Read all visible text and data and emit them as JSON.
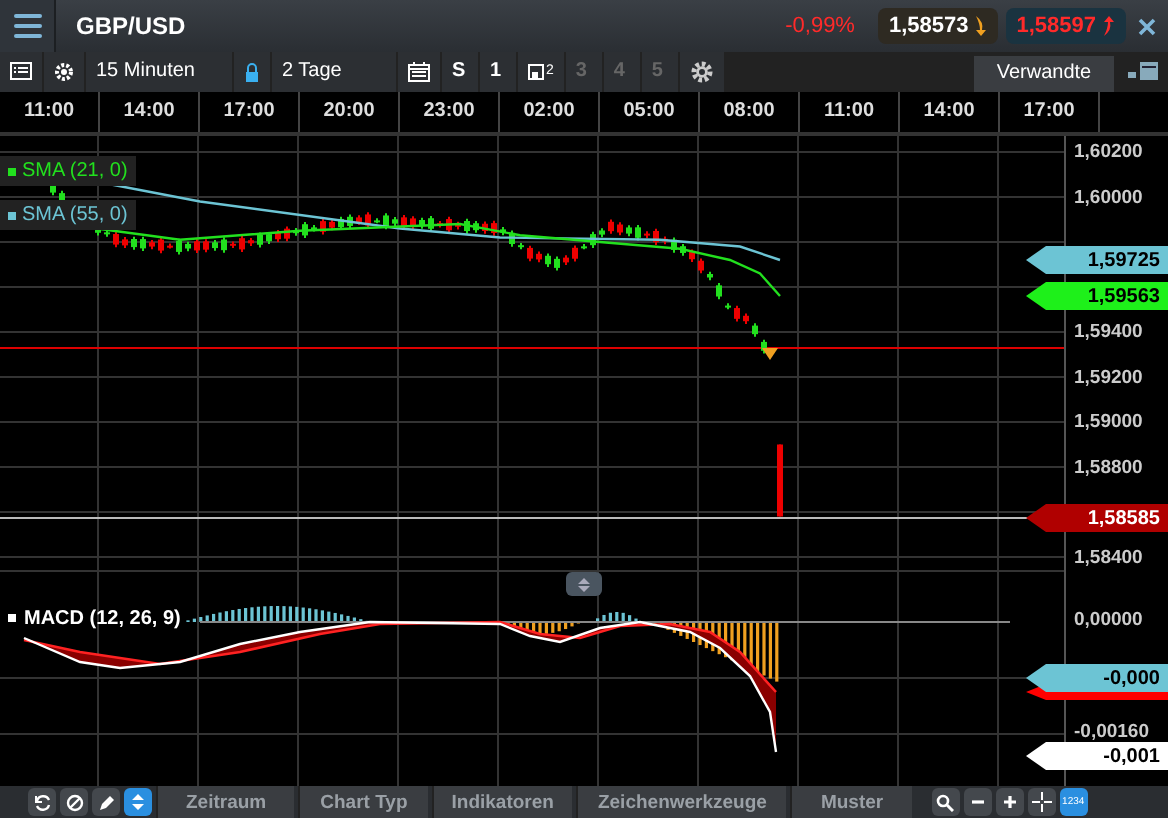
{
  "header": {
    "symbol": "GBP/USD",
    "change": "-0,99%",
    "sell": {
      "price": "1,58573"
    },
    "buy": {
      "price": "1,58597"
    }
  },
  "toolbar": {
    "interval": "15 Minuten",
    "range": "2 Tage",
    "slots": [
      {
        "kind": "text",
        "label": "S",
        "disabled": false
      },
      {
        "kind": "text",
        "label": "1",
        "disabled": false
      },
      {
        "kind": "window",
        "label": "2",
        "disabled": false
      },
      {
        "kind": "text",
        "label": "3",
        "disabled": true
      },
      {
        "kind": "text",
        "label": "4",
        "disabled": true
      },
      {
        "kind": "text",
        "label": "5",
        "disabled": true
      }
    ],
    "related_tab": "Verwandte"
  },
  "time_axis": [
    "11:00",
    "14:00",
    "17:00",
    "20:00",
    "23:00",
    "02:00",
    "05:00",
    "08:00",
    "11:00",
    "14:00",
    "17:00"
  ],
  "price_axis": [
    "1,60200",
    "1,60000",
    "1,59400",
    "1,59200",
    "1,59000",
    "1,58800",
    "1,58400"
  ],
  "legend": [
    {
      "label": "SMA (21, 0)",
      "color": "#22e01e"
    },
    {
      "label": "SMA (55, 0)",
      "color": "#6cc4d4"
    }
  ],
  "price_tags": [
    {
      "value": "1,59725",
      "color": "#6cc4d4"
    },
    {
      "value": "1,59563",
      "color": "#1ef01a"
    },
    {
      "value": "1,58585",
      "color": "#b00000"
    }
  ],
  "macd": {
    "label": "MACD (12, 26, 9)",
    "axis": [
      "0,00000",
      "-0,00160"
    ],
    "tags": [
      {
        "value": "-0,000",
        "color": "#6cc4d4"
      },
      {
        "value": "-0,001",
        "color": "#ffffff"
      }
    ]
  },
  "bottom_tabs": [
    "Zeitraum",
    "Chart Typ",
    "Indikatoren",
    "Zeichenwerkzeuge",
    "Muster"
  ],
  "numbers_badge": "1234"
}
